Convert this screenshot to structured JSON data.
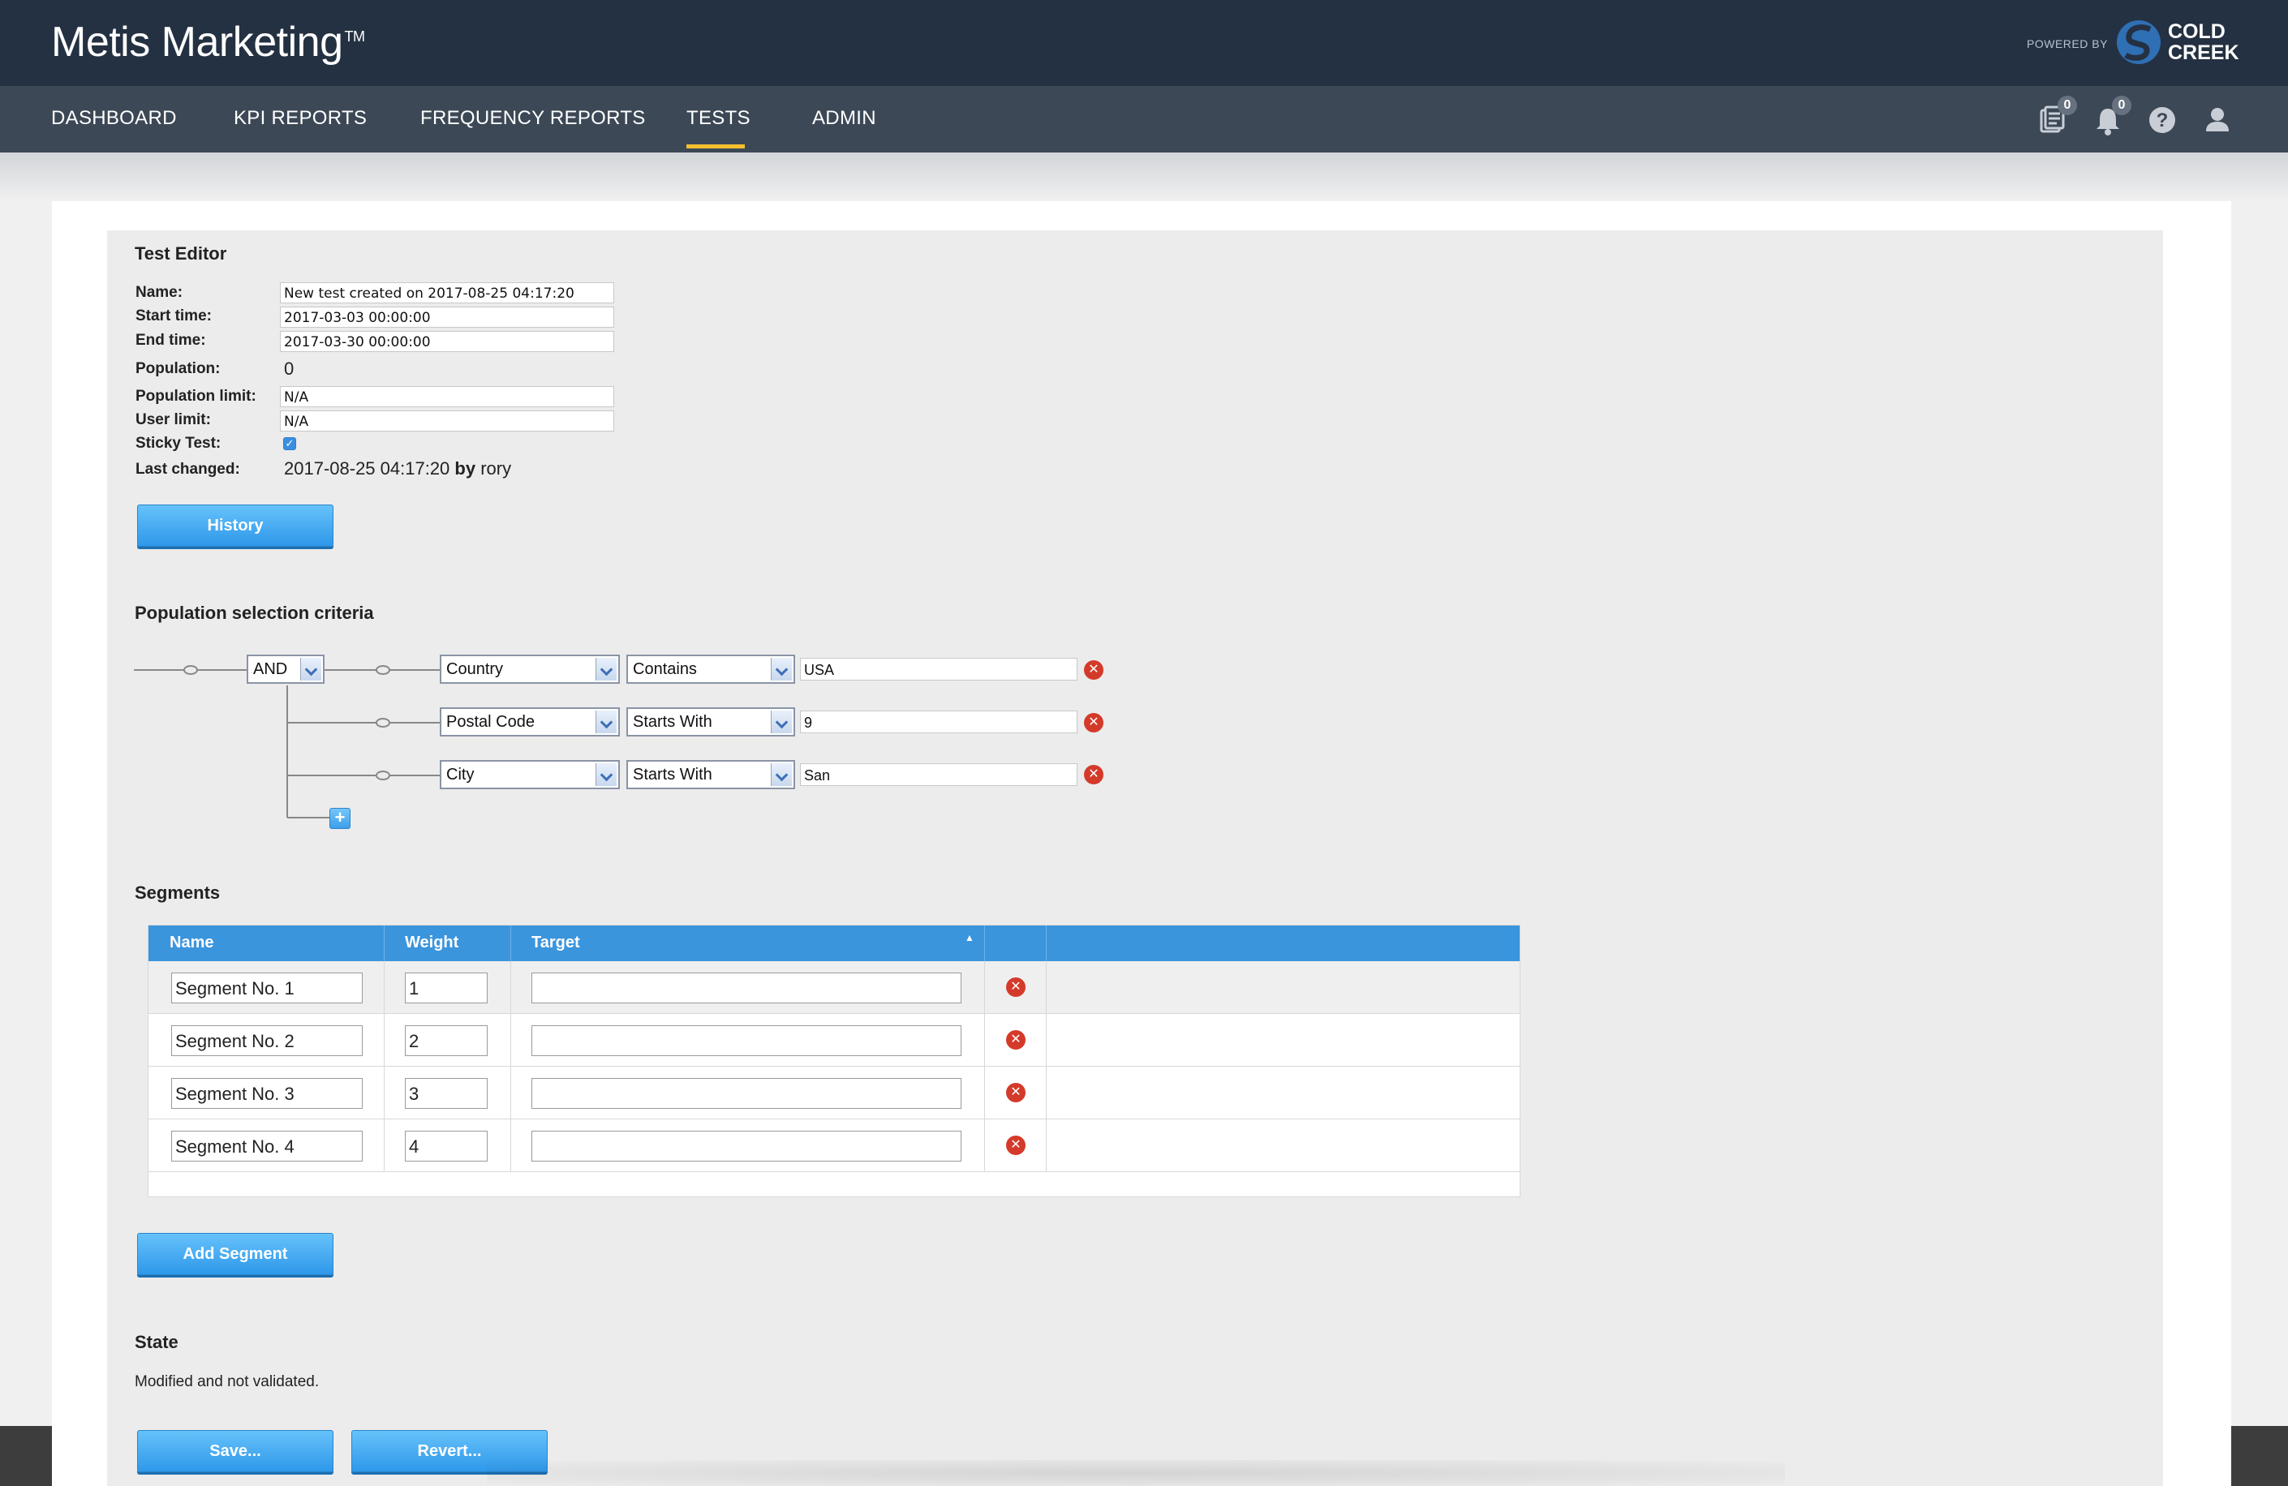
{
  "app": {
    "brand": "Metis Marketing",
    "trademark": "TM",
    "powered_by": "POWERED BY",
    "partner_line1": "COLD",
    "partner_line2": "CREEK"
  },
  "nav": {
    "items": [
      {
        "label": "DASHBOARD",
        "active": false
      },
      {
        "label": "KPI REPORTS",
        "active": false
      },
      {
        "label": "FREQUENCY REPORTS",
        "active": false
      },
      {
        "label": "TESTS",
        "active": true
      },
      {
        "label": "ADMIN",
        "active": false
      }
    ],
    "icons": [
      {
        "name": "reports-icon",
        "badge": "0"
      },
      {
        "name": "bell-icon",
        "badge": "0"
      },
      {
        "name": "help-icon"
      },
      {
        "name": "user-icon"
      }
    ],
    "active_color": "#f5c02e"
  },
  "editor": {
    "title": "Test Editor",
    "fields": {
      "name_label": "Name:",
      "name_value": "New test created on 2017-08-25 04:17:20",
      "start_label": "Start time:",
      "start_value": "2017-03-03 00:00:00",
      "end_label": "End time:",
      "end_value": "2017-03-30 00:00:00",
      "population_label": "Population:",
      "population_value": "0",
      "population_limit_label": "Population limit:",
      "population_limit_value": "N/A",
      "user_limit_label": "User limit:",
      "user_limit_value": "N/A",
      "sticky_label": "Sticky Test:",
      "sticky_checked": true,
      "last_changed_label": "Last changed:",
      "last_changed_date": "2017-08-25 04:17:20",
      "last_changed_by": "by",
      "last_changed_user": "rory"
    },
    "history_button": "History"
  },
  "criteria": {
    "title": "Population selection criteria",
    "operator": "AND",
    "rows": [
      {
        "field": "Country",
        "op": "Contains",
        "value": "USA"
      },
      {
        "field": "Postal Code",
        "op": "Starts With",
        "value": "9"
      },
      {
        "field": "City",
        "op": "Starts With",
        "value": "San"
      }
    ],
    "add_symbol": "+"
  },
  "segments": {
    "title": "Segments",
    "columns": [
      "Name",
      "Weight",
      "Target"
    ],
    "rows": [
      {
        "name": "Segment No. 1",
        "weight": "1",
        "target": ""
      },
      {
        "name": "Segment No. 2",
        "weight": "2",
        "target": ""
      },
      {
        "name": "Segment No. 3",
        "weight": "3",
        "target": ""
      },
      {
        "name": "Segment No. 4",
        "weight": "4",
        "target": ""
      }
    ],
    "add_button": "Add Segment",
    "header_color": "#3b95dd"
  },
  "state": {
    "title": "State",
    "text": "Modified and not validated."
  },
  "actions": {
    "save": "Save...",
    "revert": "Revert..."
  }
}
